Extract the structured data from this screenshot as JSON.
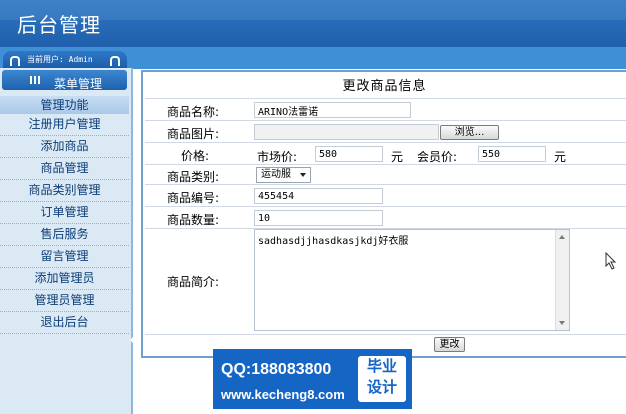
{
  "header": {
    "title": "后台管理"
  },
  "user_bar": {
    "current_user": "当前用户: Admin"
  },
  "sidebar": {
    "menu_tab": "菜单管理",
    "section_title": "管理功能",
    "items": [
      "注册用户管理",
      "添加商品",
      "商品管理",
      "商品类别管理",
      "订单管理",
      "售后服务",
      "留言管理",
      "添加管理员",
      "管理员管理",
      "退出后台"
    ]
  },
  "form": {
    "title": "更改商品信息",
    "name_label": "商品名称:",
    "name_value": "ARINO法雷诺",
    "image_label": "商品图片:",
    "image_value": "",
    "browse_button": "浏览...",
    "price_label": "价格:",
    "market_price_label": "市场价:",
    "market_price_value": "580",
    "member_price_label": "会员价:",
    "member_price_value": "550",
    "currency_unit": "元",
    "category_label": "商品类别:",
    "category_value": "运动服",
    "code_label": "商品编号:",
    "code_value": "455454",
    "quantity_label": "商品数量:",
    "quantity_value": "10",
    "intro_label": "商品简介:",
    "intro_value": "sadhasdjjhasdkasjkdj好衣服",
    "submit_button": "更改"
  },
  "watermark": {
    "qq": "QQ:188083800",
    "site": "www.kecheng8.com",
    "badge_line1": "毕业",
    "badge_line2": "设计"
  }
}
